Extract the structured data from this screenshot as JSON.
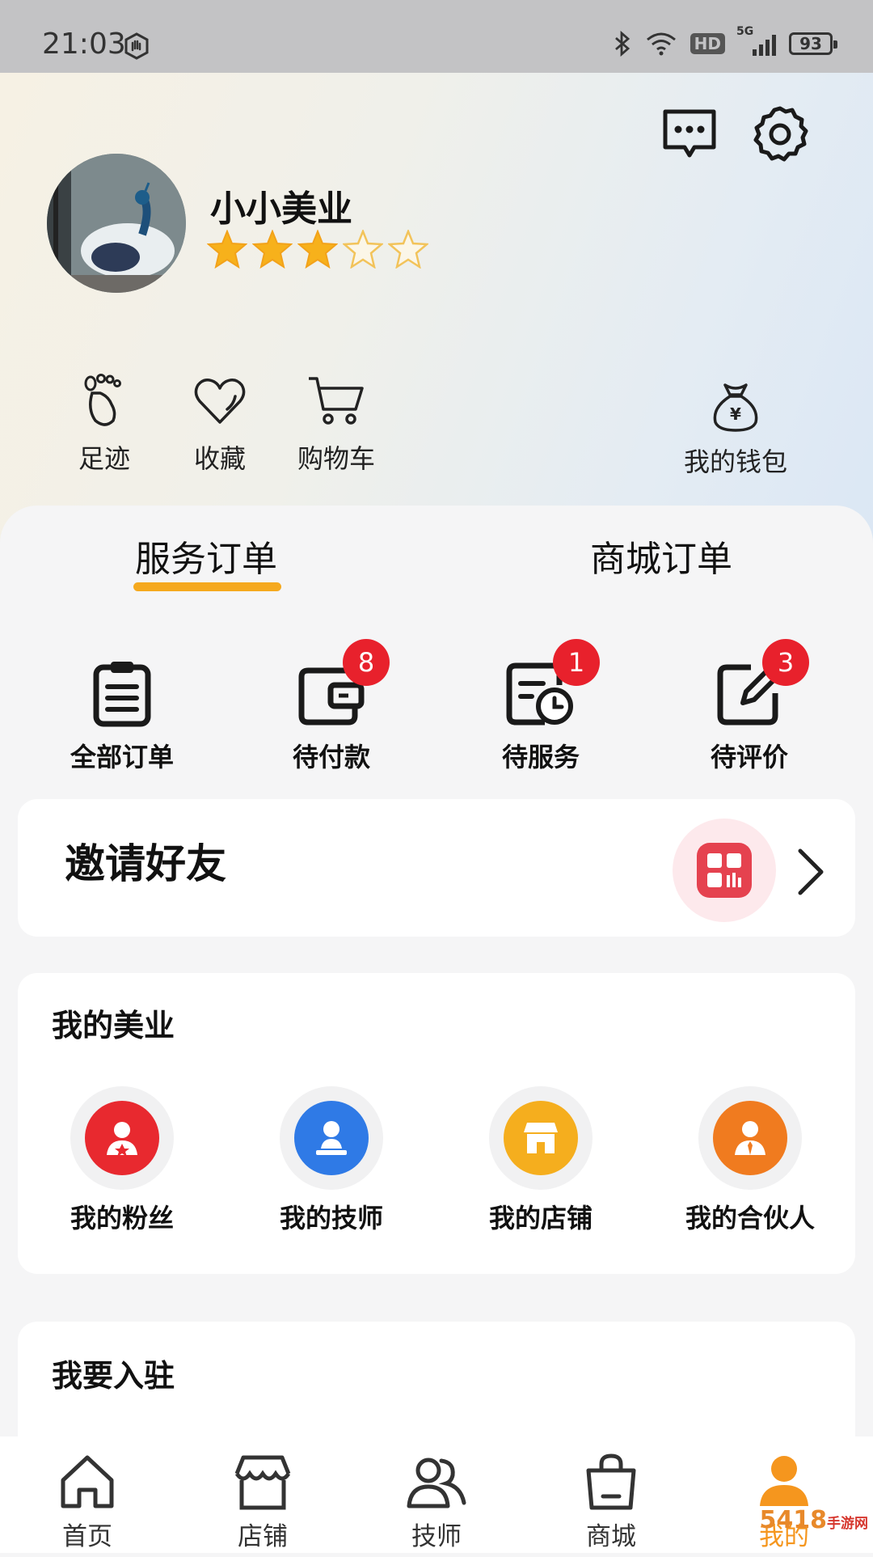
{
  "status_bar": {
    "time": "21:03",
    "network_badge": "HD",
    "signal_label": "5G",
    "battery": "93"
  },
  "profile": {
    "name": "小小美业",
    "rating_stars": 3,
    "rating_max": 5
  },
  "quick_links": [
    {
      "label": "足迹",
      "icon": "footprint-icon"
    },
    {
      "label": "收藏",
      "icon": "heart-icon"
    },
    {
      "label": "购物车",
      "icon": "cart-icon"
    }
  ],
  "wallet": {
    "label": "我的钱包",
    "symbol": "¥"
  },
  "order_tabs": {
    "service": "服务订单",
    "mall": "商城订单",
    "active": "service"
  },
  "orders": [
    {
      "label": "全部订单",
      "icon": "clipboard-icon",
      "badge": ""
    },
    {
      "label": "待付款",
      "icon": "wallet-icon",
      "badge": "8"
    },
    {
      "label": "待服务",
      "icon": "schedule-icon",
      "badge": "1"
    },
    {
      "label": "待评价",
      "icon": "edit-icon",
      "badge": "3"
    }
  ],
  "invite": {
    "title": "邀请好友"
  },
  "my_beauty": {
    "title": "我的美业",
    "items": [
      {
        "label": "我的粉丝",
        "color": "#e8292f",
        "icon": "fans-icon"
      },
      {
        "label": "我的技师",
        "color": "#2f7ae6",
        "icon": "technician-icon"
      },
      {
        "label": "我的店铺",
        "color": "#f5ae1e",
        "icon": "store-icon"
      },
      {
        "label": "我的合伙人",
        "color": "#f07b1f",
        "icon": "partner-icon"
      }
    ]
  },
  "join": {
    "title": "我要入驻"
  },
  "bottom_nav": [
    {
      "label": "首页",
      "icon": "home-icon",
      "active": false
    },
    {
      "label": "店铺",
      "icon": "shop-icon",
      "active": false
    },
    {
      "label": "技师",
      "icon": "people-icon",
      "active": false
    },
    {
      "label": "商城",
      "icon": "bag-icon",
      "active": false
    },
    {
      "label": "我的",
      "icon": "user-icon",
      "active": true
    }
  ],
  "watermark": {
    "brand": "5418",
    "site": "手游网"
  },
  "colors": {
    "accent": "#f5a91e",
    "badge": "#e8212c",
    "active_nav": "#f5961e"
  }
}
